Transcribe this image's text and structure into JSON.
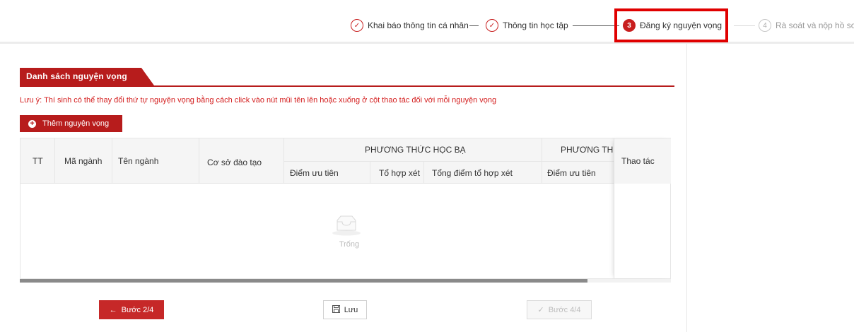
{
  "stepper": {
    "steps": [
      {
        "label": "Khai báo thông tin cá nhân",
        "marker": "✓",
        "state": "done"
      },
      {
        "label": "Thông tin học tập",
        "marker": "✓",
        "state": "done"
      },
      {
        "label": "Đăng ký nguyện vọng",
        "marker": "3",
        "state": "active"
      },
      {
        "label": "Rà soát và nộp hồ sơ",
        "marker": "4",
        "state": "todo"
      }
    ],
    "separator": "—"
  },
  "section": {
    "title": "Danh sách nguyện vọng"
  },
  "note": "Lưu ý: Thí sinh có thể thay đổi thứ tự nguyện vọng bằng cách click vào nút mũi tên lên hoặc xuống ở cột thao tác đối với mỗi nguyện vọng",
  "add_button": {
    "icon": "plus-circle-icon",
    "label": "Thêm nguyện vọng"
  },
  "table": {
    "headers": {
      "tt": "TT",
      "ma_nganh": "Mã ngành",
      "ten_nganh": "Tên ngành",
      "co_so": "Cơ sở đào tạo",
      "group1": "PHƯƠNG THỨC HỌC BẠ",
      "group2": "PHƯƠNG THỨ",
      "diem_uu_tien_1": "Điểm ưu tiên",
      "to_hop_xet": "Tổ hợp xét",
      "tong_diem": "Tổng điểm tổ hợp xét",
      "diem_uu_tien_2": "Điểm ưu tiên",
      "thao_tac": "Thao tác"
    },
    "empty_text": "Trống",
    "rows": []
  },
  "footer": {
    "prev_label": "Bước 2/4",
    "prev_icon": "arrow-left-icon",
    "save_label": "Lưu",
    "save_icon": "save-icon",
    "next_label": "Bước 4/4",
    "next_icon": "check-icon"
  },
  "colors": {
    "brand_red": "#b71c1c",
    "note_red": "#d41f1f",
    "highlight": "#e00000"
  }
}
